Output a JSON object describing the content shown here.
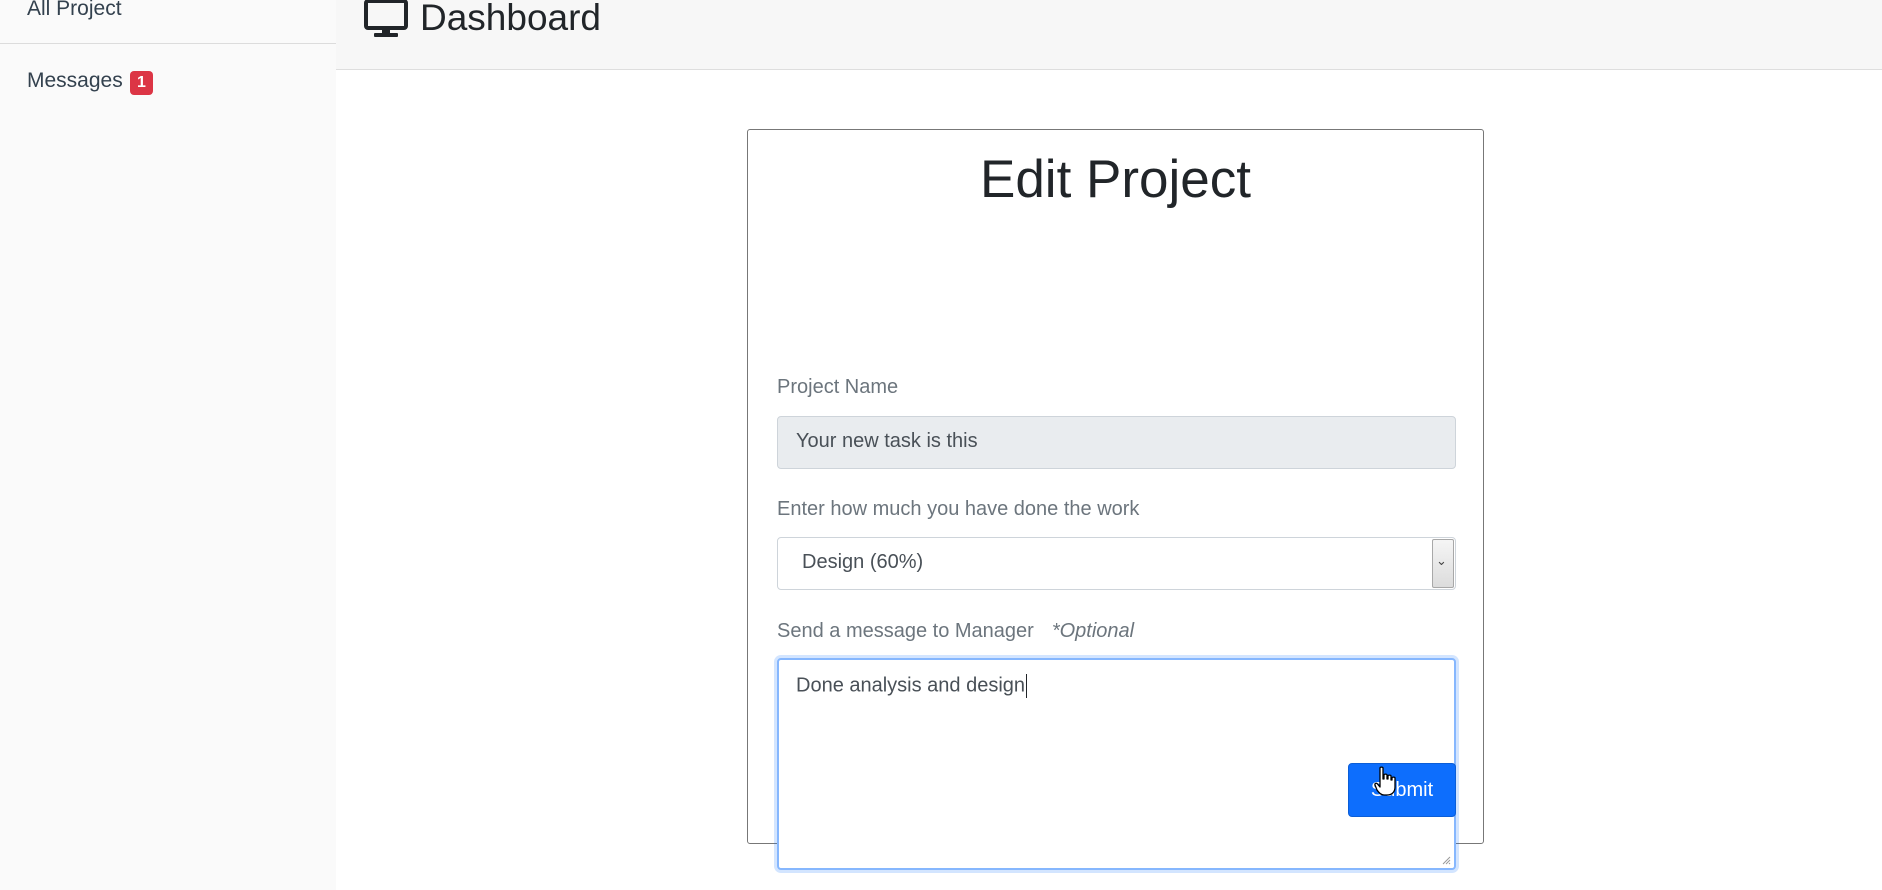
{
  "sidebar": {
    "items": [
      {
        "label": "All Project"
      },
      {
        "label": "Messages",
        "badge": "1"
      }
    ]
  },
  "header": {
    "icon": "monitor-icon",
    "title": "Dashboard"
  },
  "form": {
    "title": "Edit Project",
    "project_name": {
      "label": "Project Name",
      "value": "Your new task is this"
    },
    "progress": {
      "label": "Enter how much you have done the work",
      "selected": "Design (60%)"
    },
    "message": {
      "label": "Send a message to Manager",
      "optional": "*Optional",
      "value": "Done analysis and design"
    },
    "submit_label": "Submit"
  },
  "colors": {
    "accent": "#0d6efd",
    "badge": "#dc3545",
    "focus_border": "#86b7fe"
  }
}
